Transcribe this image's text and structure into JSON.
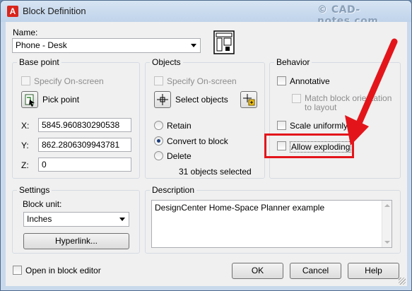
{
  "window": {
    "title": "Block Definition",
    "watermark": "© CAD-notes.com"
  },
  "name": {
    "label": "Name:",
    "value": "Phone - Desk"
  },
  "base_point": {
    "title": "Base point",
    "specify_onscreen": "Specify On-screen",
    "pick_point": "Pick point",
    "x_label": "X:",
    "x_value": "5845.960830290538",
    "y_label": "Y:",
    "y_value": "862.2806309943781",
    "z_label": "Z:",
    "z_value": "0"
  },
  "objects": {
    "title": "Objects",
    "specify_onscreen": "Specify On-screen",
    "select_objects": "Select objects",
    "retain": "Retain",
    "convert_to_block": "Convert to block",
    "delete": "Delete",
    "selected_count": "31 objects selected"
  },
  "behavior": {
    "title": "Behavior",
    "annotative": "Annotative",
    "match_orientation_1": "Match block orientation",
    "match_orientation_2": "to layout",
    "scale_uniformly": "Scale uniformly",
    "allow_exploding": "Allow exploding"
  },
  "settings": {
    "title": "Settings",
    "block_unit_label": "Block unit:",
    "block_unit_value": "Inches",
    "hyperlink": "Hyperlink..."
  },
  "description": {
    "title": "Description",
    "text": "DesignCenter Home-Space Planner example"
  },
  "footer": {
    "open_in_editor": "Open in block editor",
    "ok": "OK",
    "cancel": "Cancel",
    "help": "Help"
  },
  "colors": {
    "annotation_red": "#e3151b",
    "title_bar": "#c9d9ec"
  }
}
